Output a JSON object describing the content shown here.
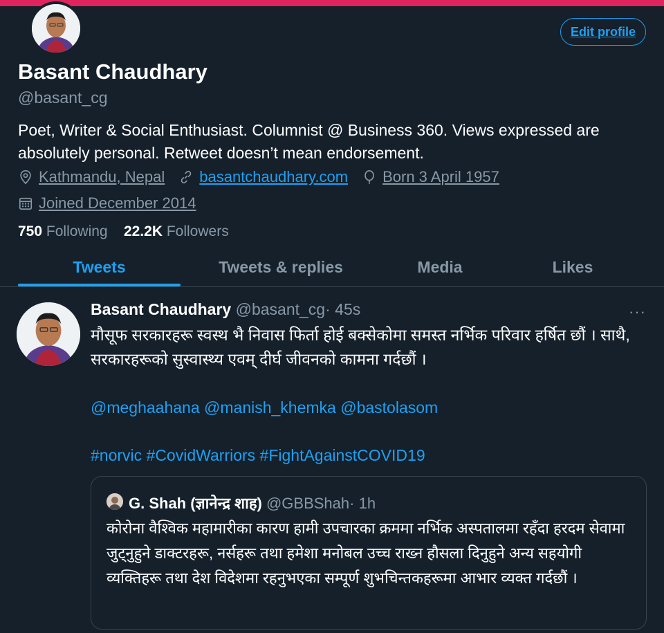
{
  "profile": {
    "name": "Basant Chaudhary",
    "handle": "@basant_cg",
    "edit_label": "Edit profile",
    "bio": "Poet, Writer & Social Enthusiast. Columnist @ Business 360. Views expressed are absolutely personal. Retweet doesn’t mean endorsement.",
    "location": "Kathmandu, Nepal",
    "website": "basantchaudhary.com",
    "birthday": "Born 3 April 1957",
    "joined": "Joined December 2014",
    "following_count": "750",
    "following_label": "Following",
    "followers_count": "22.2K",
    "followers_label": "Followers"
  },
  "tabs": [
    {
      "label": "Tweets",
      "active": true
    },
    {
      "label": "Tweets & replies"
    },
    {
      "label": "Media"
    },
    {
      "label": "Likes"
    }
  ],
  "tweet": {
    "name": "Basant Chaudhary",
    "handle": "@basant_cg",
    "time": "· 45s",
    "more": "···",
    "text": "मौसूफ सरकारहरू स्वस्थ भै निवास फिर्ता होई बक्सेकोमा समस्त नर्भिक परिवार हर्षित छौं । साथै, सरकारहरूको सुस्वास्थ्य एवम् दीर्घ जीवनको कामना गर्दछौं ।",
    "mentions": "@meghaahana @manish_khemka @bastolasom",
    "hashtags": "#norvic #CovidWarriors #FightAgainstCOVID19",
    "quote": {
      "name": "G. Shah (ज्ञानेन्द्र शाह)",
      "handle": "@GBBShah",
      "time": "· 1h",
      "text": "कोरोना वैश्विक महामारीका कारण हामी उपचारका क्रममा नर्भिक अस्पतालमा रहँदा हरदम सेवामा जुट्नुहुने डाक्टरहरू, नर्सहरू तथा हमेशा मनोबल उच्च राख्न हौसला दिनुहुने अन्य सहयोगी व्यक्तिहरू तथा देश विदेशमा रहनुभएका सम्पूर्ण शुभचिन्तकहरूमा आभार व्यक्त गर्दछौं ।"
    }
  },
  "colors": {
    "background": "#15202b",
    "accent": "#1da1f2",
    "muted": "#8899a6",
    "top_bar": "#e0245e",
    "divider": "#38444d"
  },
  "icons": [
    "location-icon",
    "link-icon",
    "balloon-icon",
    "calendar-icon",
    "more-icon"
  ]
}
